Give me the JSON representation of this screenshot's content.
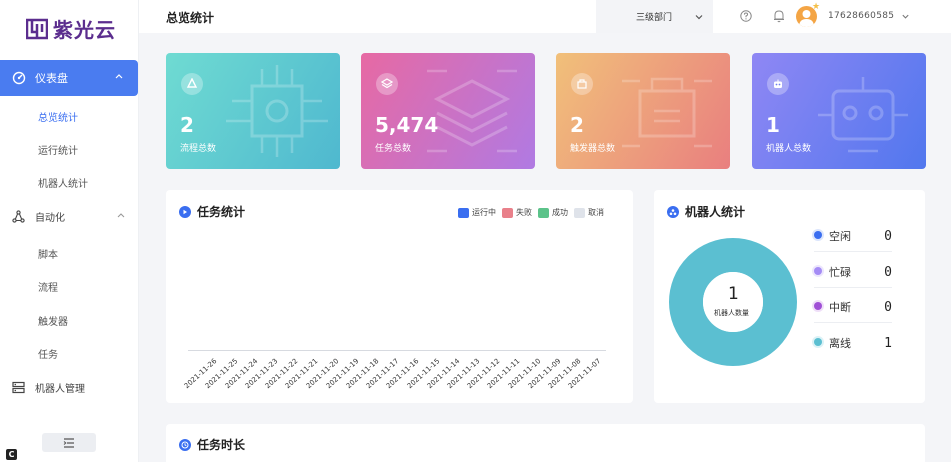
{
  "brand": {
    "name": "紫光云",
    "color": "#5b2d8e"
  },
  "sidebar": {
    "active": {
      "label": "仪表盘",
      "icon": "dashboard-icon"
    },
    "sub_items": [
      {
        "label": "总览统计",
        "active": true
      },
      {
        "label": "运行统计",
        "active": false
      },
      {
        "label": "机器人统计",
        "active": false
      }
    ],
    "automation": {
      "label": "自动化",
      "icon": "automation-icon"
    },
    "automation_items": [
      {
        "label": "脚本"
      },
      {
        "label": "流程"
      },
      {
        "label": "触发器"
      },
      {
        "label": "任务"
      }
    ],
    "robot_mgmt": {
      "label": "机器人管理",
      "icon": "robot-management-icon"
    }
  },
  "header": {
    "title": "总览统计",
    "dept": "三级部门",
    "phone": "17628660585"
  },
  "stats": [
    {
      "value": "2",
      "label": "流程总数",
      "icon": "process-icon"
    },
    {
      "value": "5,474",
      "label": "任务总数",
      "icon": "layers-icon"
    },
    {
      "value": "2",
      "label": "触发器总数",
      "icon": "trigger-icon"
    },
    {
      "value": "1",
      "label": "机器人总数",
      "icon": "robot-icon"
    }
  ],
  "task_stats": {
    "title": "任务统计",
    "legend": [
      {
        "label": "运行中",
        "color": "#3a6ef0"
      },
      {
        "label": "失败",
        "color": "#e9808a"
      },
      {
        "label": "成功",
        "color": "#5cc38a"
      },
      {
        "label": "取消",
        "color": "#dfe3ea"
      }
    ],
    "dates": [
      "2021-11-26",
      "2021-11-25",
      "2021-11-24",
      "2021-11-23",
      "2021-11-22",
      "2021-11-21",
      "2021-11-20",
      "2021-11-19",
      "2021-11-18",
      "2021-11-17",
      "2021-11-16",
      "2021-11-15",
      "2021-11-14",
      "2021-11-13",
      "2021-11-12",
      "2021-11-11",
      "2021-11-10",
      "2021-11-09",
      "2021-11-08",
      "2021-11-07"
    ]
  },
  "robot_stats": {
    "title": "机器人统计",
    "total": "1",
    "total_label": "机器人数量",
    "rows": [
      {
        "label": "空闲",
        "value": "0",
        "color": "#3a6ef0"
      },
      {
        "label": "忙碌",
        "value": "0",
        "color": "#a58cf5"
      },
      {
        "label": "中断",
        "value": "0",
        "color": "#a04fd6"
      },
      {
        "label": "离线",
        "value": "1",
        "color": "#5bbfd1"
      }
    ]
  },
  "task_duration": {
    "title": "任务时长"
  }
}
